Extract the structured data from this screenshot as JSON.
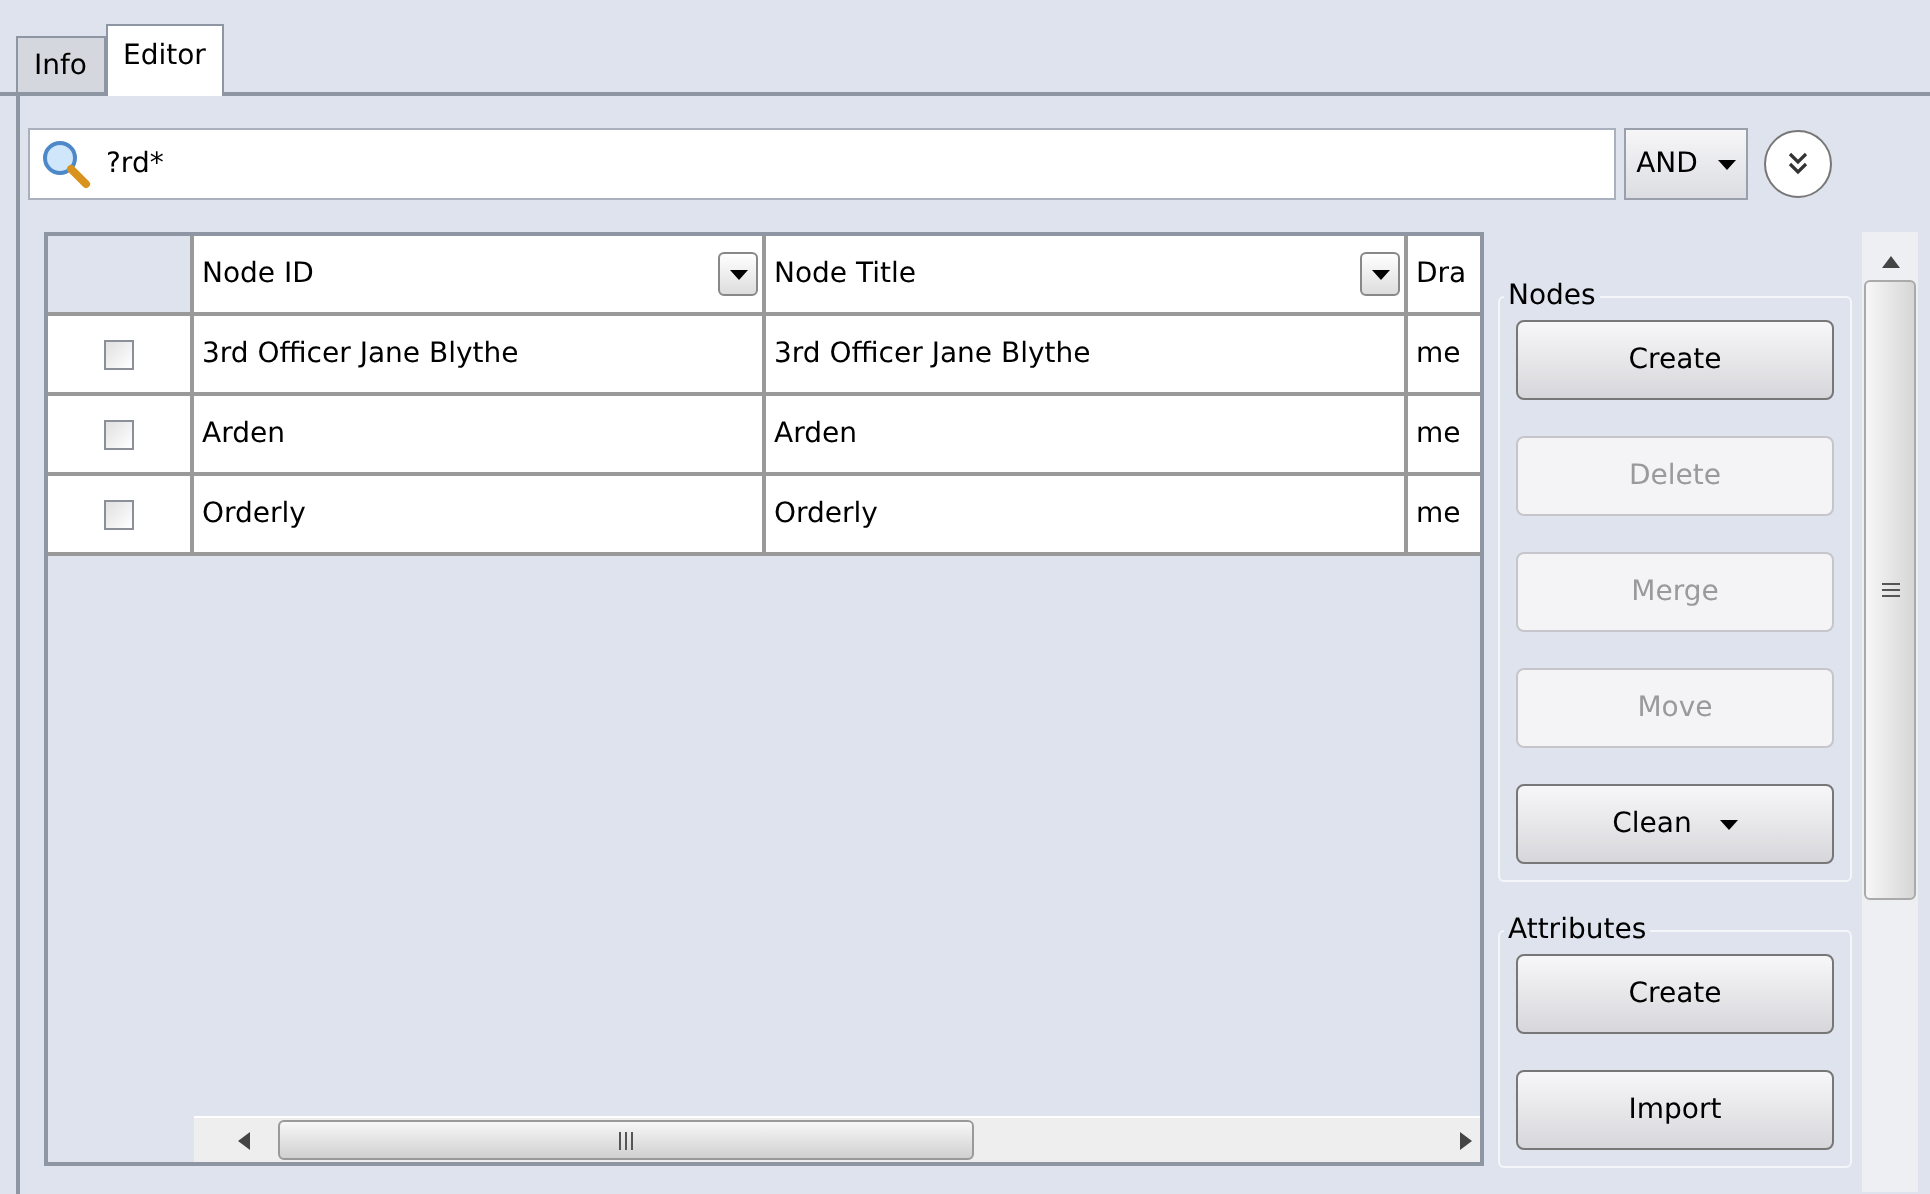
{
  "tabs": [
    {
      "label": "Info",
      "selected": false
    },
    {
      "label": "Editor",
      "selected": true
    }
  ],
  "search": {
    "value": "?rd*"
  },
  "operator": {
    "label": "AND"
  },
  "table": {
    "columns": [
      {
        "label": "Node ID",
        "has_filter": true
      },
      {
        "label": "Node Title",
        "has_filter": true
      },
      {
        "label": "Dra",
        "has_filter": false
      }
    ],
    "rows": [
      {
        "checked": false,
        "cells": [
          "3rd Officer Jane Blythe",
          "3rd Officer Jane Blythe",
          "me"
        ]
      },
      {
        "checked": false,
        "cells": [
          "Arden",
          "Arden",
          "me"
        ]
      },
      {
        "checked": false,
        "cells": [
          "Orderly",
          "Orderly",
          "me"
        ]
      }
    ]
  },
  "groups": [
    {
      "title": "Nodes",
      "buttons": [
        {
          "label": "Create",
          "kind": "push",
          "disabled": false
        },
        {
          "label": "Delete",
          "kind": "push",
          "disabled": true
        },
        {
          "label": "Merge",
          "kind": "push",
          "disabled": true
        },
        {
          "label": "Move",
          "kind": "push",
          "disabled": true
        },
        {
          "label": "Clean",
          "kind": "menu",
          "disabled": false
        }
      ]
    },
    {
      "title": "Attributes",
      "buttons": [
        {
          "label": "Create",
          "kind": "push",
          "disabled": false
        },
        {
          "label": "Import",
          "kind": "push",
          "disabled": false
        }
      ]
    }
  ]
}
